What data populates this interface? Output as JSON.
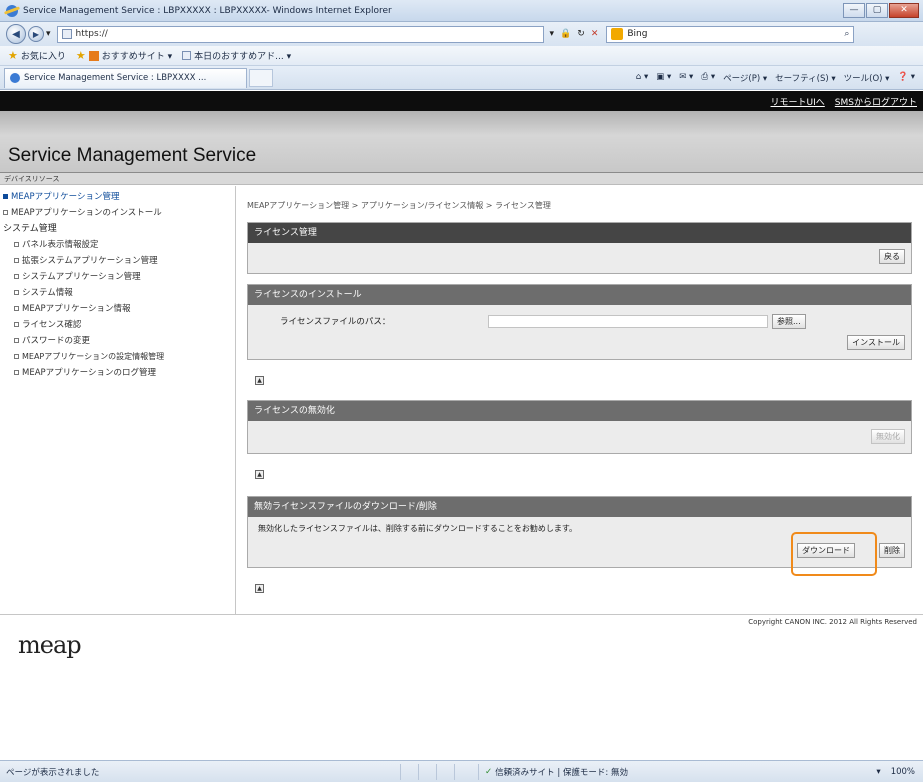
{
  "window": {
    "title": "Service Management Service : LBPXXXXX : LBPXXXXX- Windows Internet Explorer",
    "controls": {
      "minimize": "—",
      "maximize": "▢",
      "close": "✕"
    }
  },
  "addressbar": {
    "url": "https://",
    "search_engine": "Bing",
    "icons": {
      "lock": "🔒",
      "refresh": "↻",
      "stop": "✕",
      "back": "◀",
      "forward": "▶",
      "dropdown": "▾",
      "search": "⌕"
    }
  },
  "favorites": {
    "label": "お気に入り",
    "items": [
      "おすすめサイト ▾",
      "本日のおすすめアド... ▾"
    ]
  },
  "tab": {
    "title": "Service Management Service : LBPXXXX ..."
  },
  "commandbar": {
    "items": [
      "⌂ ▾",
      "▣ ▾",
      "✉ ▾",
      "⎙ ▾",
      "ページ(P) ▾",
      "セーフティ(S) ▾",
      "ツール(O) ▾",
      "❓ ▾"
    ]
  },
  "header": {
    "links": [
      "リモートUIへ",
      "SMSからログアウト"
    ],
    "app_title": "Service Management Service",
    "device_strip": "デバイスリソース"
  },
  "sidebar": {
    "items": [
      {
        "label": "MEAPアプリケーション管理",
        "level": 0,
        "active": true
      },
      {
        "label": "MEAPアプリケーションのインストール",
        "level": 0,
        "active": false
      }
    ],
    "system_heading": "システム管理",
    "system_items": [
      "パネル表示情報設定",
      "拡張システムアプリケーション管理",
      "システムアプリケーション管理",
      "システム情報",
      "MEAPアプリケーション情報",
      "ライセンス確認",
      "パスワードの変更",
      "MEAPアプリケーションの設定情報管理",
      "MEAPアプリケーションのログ管理"
    ]
  },
  "main": {
    "breadcrumb": "MEAPアプリケーション管理 > アプリケーション/ライセンス情報 > ライセンス管理",
    "license_mgmt": {
      "title": "ライセンス管理",
      "back_button": "戻る"
    },
    "install": {
      "title": "ライセンスのインストール",
      "path_label": "ライセンスファイルのパス：",
      "path_value": "",
      "browse_button": "参照...",
      "install_button": "インストール"
    },
    "disable": {
      "title": "ライセンスの無効化",
      "disable_button": "無効化"
    },
    "download": {
      "title": "無効ライセンスファイルのダウンロード/削除",
      "message": "無効化したライセンスファイルは、削除する前にダウンロードすることをお勧めします。",
      "download_button": "ダウンロード",
      "delete_button": "削除"
    },
    "to_top": "▲"
  },
  "footer": {
    "copyright": "Copyright CANON INC. 2012 All Rights Reserved",
    "logo": "meap"
  },
  "statusbar": {
    "left": "ページが表示されました",
    "zone": "信頼済みサイト | 保護モード: 無効",
    "zoom": "100%",
    "zoom_menu": "▾"
  },
  "colors": {
    "highlight": "#f08a1a",
    "section_header": "#6d6d6d",
    "logo_dot": "#d01b1b"
  }
}
